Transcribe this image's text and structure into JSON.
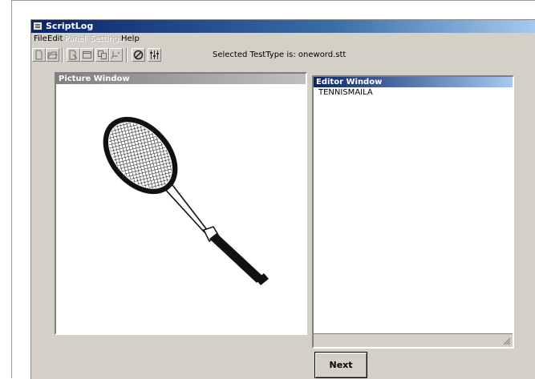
{
  "window": {
    "title": "ScriptLog"
  },
  "menu": [
    {
      "label": "File",
      "enabled": true
    },
    {
      "label": "Edit",
      "enabled": true
    },
    {
      "label": "Panel",
      "enabled": false
    },
    {
      "label": "Settings",
      "enabled": false
    },
    {
      "label": "Help",
      "enabled": true
    }
  ],
  "toolbar": {
    "status": "Selected TestType is: oneword.stt",
    "icons": [
      "new-file-icon",
      "open-folder-icon",
      "edit-doc-icon",
      "window-icon",
      "copy-icon",
      "cut-icon",
      "stop-icon",
      "mixer-icon"
    ]
  },
  "picture_window": {
    "title": "Picture Window",
    "image": "tennis-racket"
  },
  "editor_window": {
    "title": "Editor Window",
    "text": "TENNISMAILA"
  },
  "next_button": {
    "label": "Next"
  }
}
